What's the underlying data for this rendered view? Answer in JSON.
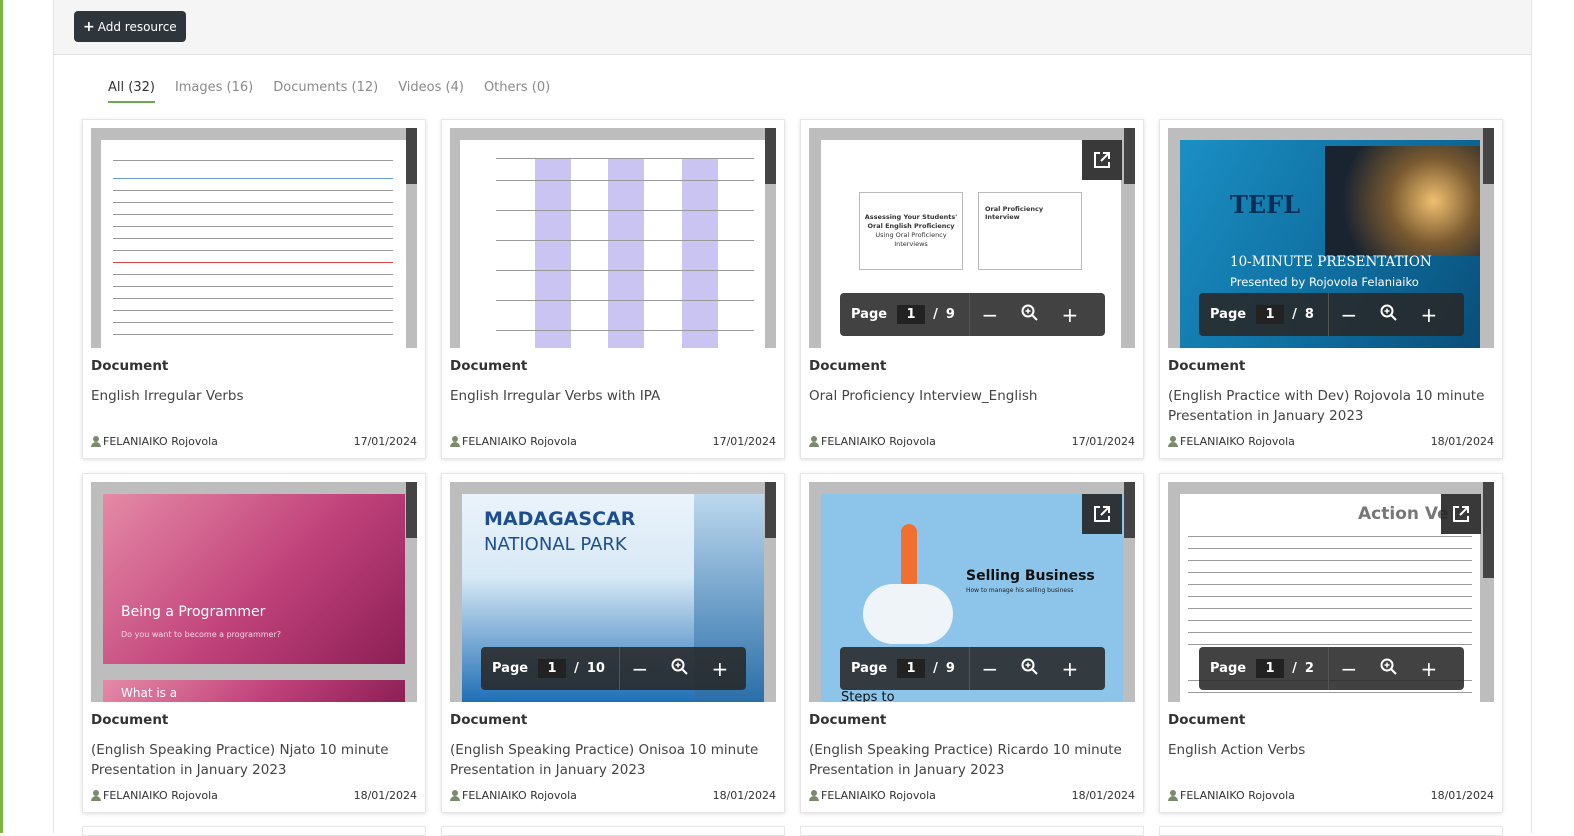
{
  "toolbar": {
    "add_label": "Add resource"
  },
  "tabs": [
    {
      "label": "All (32)"
    },
    {
      "label": "Images (16)"
    },
    {
      "label": "Documents (12)"
    },
    {
      "label": "Videos (4)"
    },
    {
      "label": "Others (0)"
    }
  ],
  "pager_label": "Page",
  "cards": [
    {
      "type": "Document",
      "title": "English Irregular Verbs",
      "author": "FELANIAIKO Rojovola",
      "date": "17/01/2024"
    },
    {
      "type": "Document",
      "title": "English Irregular Verbs with IPA",
      "author": "FELANIAIKO Rojovola",
      "date": "17/01/2024"
    },
    {
      "type": "Document",
      "title": "Oral Proficiency Interview_English",
      "author": "FELANIAIKO Rojovola",
      "date": "17/01/2024",
      "page": "1",
      "pages": "9"
    },
    {
      "type": "Document",
      "title": "(English Practice with Dev) Rojovola 10 minute Presentation in January 2023",
      "author": "FELANIAIKO Rojovola",
      "date": "18/01/2024",
      "page": "1",
      "pages": "8"
    },
    {
      "type": "Document",
      "title": "(English Speaking Practice) Njato 10 minute Presentation in January 2023",
      "author": "FELANIAIKO Rojovola",
      "date": "18/01/2024"
    },
    {
      "type": "Document",
      "title": "(English Speaking Practice) Onisoa 10 minute Presentation in January 2023",
      "author": "FELANIAIKO Rojovola",
      "date": "18/01/2024",
      "page": "1",
      "pages": "10"
    },
    {
      "type": "Document",
      "title": "(English Speaking Practice) Ricardo 10 minute Presentation in January 2023",
      "author": "FELANIAIKO Rojovola",
      "date": "18/01/2024",
      "page": "1",
      "pages": "9"
    },
    {
      "type": "Document",
      "title": "English Action Verbs",
      "author": "FELANIAIKO Rojovola",
      "date": "18/01/2024",
      "page": "1",
      "pages": "2"
    }
  ],
  "thumbs": {
    "tefl_title": "TEFL",
    "tefl_sub": "10-MINUTE PRESENTATION",
    "tefl_by": "Presented by Rojovola Felaniaiko",
    "prog_title": "Being a Programmer",
    "prog_sub": "Do you want to become a programmer?",
    "prog_foot": "What is a",
    "mada_1": "MADAGASCAR",
    "mada_2": "NATIONAL PARK",
    "sell_title": "Selling Business",
    "sell_sub": "How to manage his selling business",
    "sell_foot": "Steps to",
    "action_title": "Action Ve",
    "opi_left_1": "Assessing Your Students'",
    "opi_left_2": "Oral English Proficiency",
    "opi_left_3": "Using Oral Proficiency Interviews",
    "opi_right": "Oral Proficiency Interview"
  }
}
